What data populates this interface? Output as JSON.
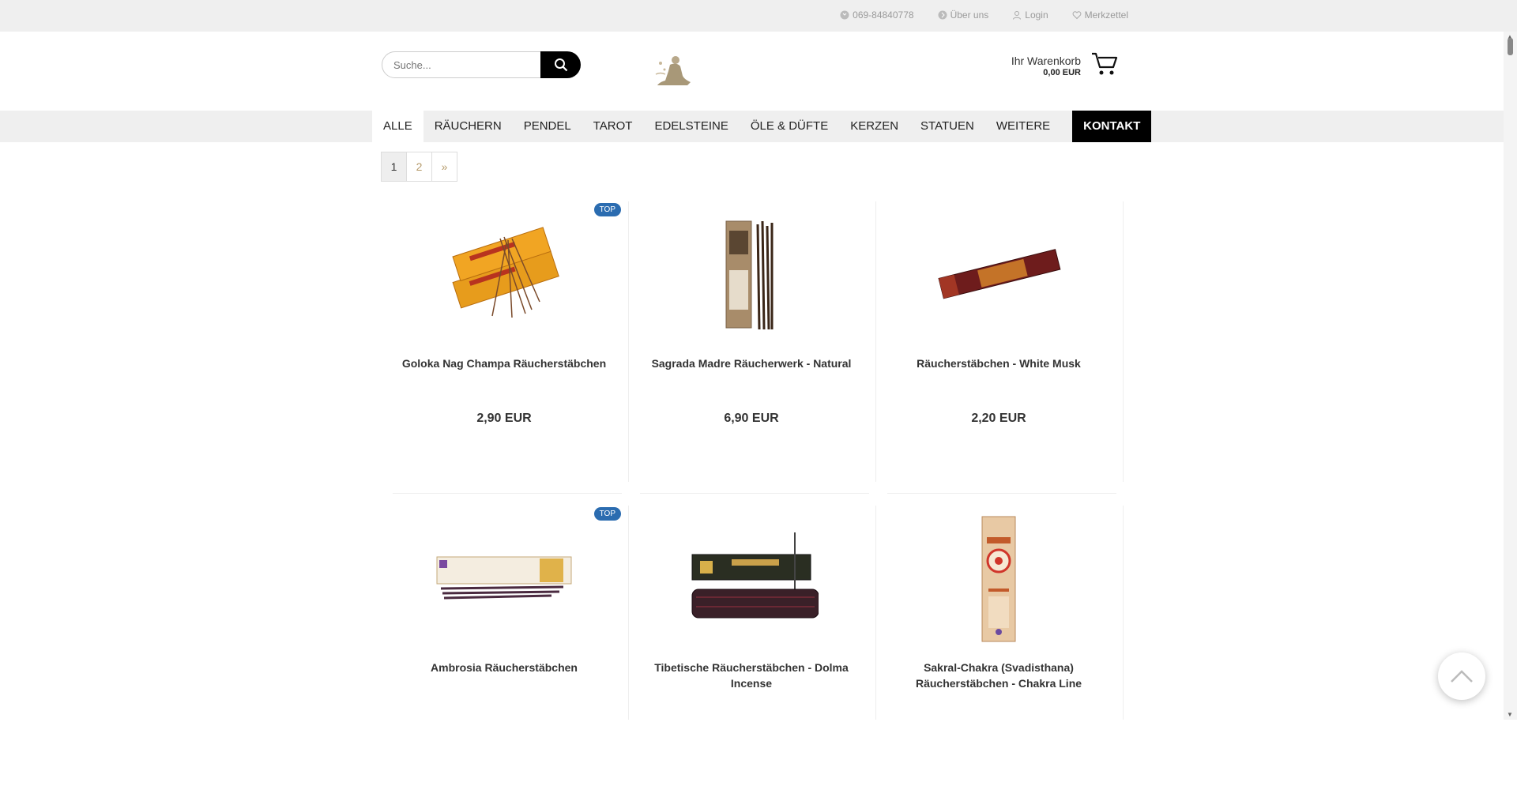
{
  "topbar": {
    "phone": "069-84840778",
    "about": "Über uns",
    "login": "Login",
    "wishlist": "Merkzettel"
  },
  "header": {
    "search_placeholder": "Suche...",
    "cart_label": "Ihr Warenkorb",
    "cart_amount": "0,00 EUR"
  },
  "nav": {
    "items": [
      "ALLE",
      "RÄUCHERN",
      "PENDEL",
      "TAROT",
      "EDELSTEINE",
      "ÖLE & DÜFTE",
      "KERZEN",
      "STATUEN",
      "WEITERE"
    ],
    "contact": "KONTAKT"
  },
  "pagination": {
    "pages": [
      "1",
      "2",
      "»"
    ],
    "current": "1"
  },
  "products": [
    {
      "name": "Goloka Nag Champa Räucherstäbchen",
      "price": "2,90 EUR",
      "badge": "TOP"
    },
    {
      "name": "Sagrada Madre Räucherwerk - Natural",
      "price": "6,90 EUR",
      "badge": ""
    },
    {
      "name": "Räucherstäbchen - White Musk",
      "price": "2,20 EUR",
      "badge": ""
    },
    {
      "name": "Ambrosia Räucherstäbchen",
      "price": "",
      "badge": "TOP"
    },
    {
      "name": "Tibetische Räucherstäbchen - Dolma Incense",
      "price": "",
      "badge": ""
    },
    {
      "name": "Sakral-Chakra (Svadisthana) Räucherstäbchen - Chakra Line",
      "price": "",
      "badge": ""
    }
  ],
  "colors": {
    "accent": "#b59a6a",
    "badge": "#2b6cb0",
    "contact_bg": "#000000",
    "nav_bg": "#efefef"
  },
  "icons": {
    "phone": "phone-icon",
    "about": "info-icon",
    "login": "user-icon",
    "wishlist": "heart-icon",
    "search": "search-icon",
    "cart": "cart-icon",
    "totop": "chevron-up-icon"
  }
}
